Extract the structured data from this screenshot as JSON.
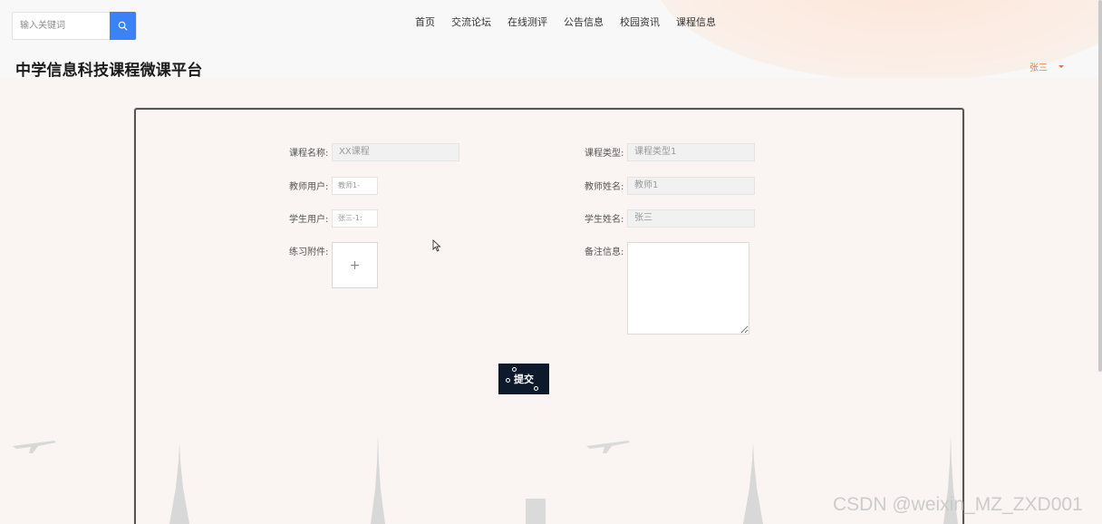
{
  "search": {
    "placeholder": "输入关键词",
    "icon": "search-icon"
  },
  "nav": [
    {
      "label": "首页"
    },
    {
      "label": "交流论坛"
    },
    {
      "label": "在线测评"
    },
    {
      "label": "公告信息"
    },
    {
      "label": "校园资讯"
    },
    {
      "label": "课程信息"
    }
  ],
  "site_title": "中学信息科技课程微课平台",
  "user": {
    "name": "张三",
    "icon": "chevron-down-icon"
  },
  "form": {
    "course_name": {
      "label": "课程名称:",
      "value": "XX课程"
    },
    "course_type": {
      "label": "课程类型:",
      "value": "课程类型1"
    },
    "teacher_user": {
      "label": "教师用户:",
      "value": "教师1-"
    },
    "teacher_name": {
      "label": "教师姓名:",
      "value": "教师1"
    },
    "student_user": {
      "label": "学生用户:",
      "value": "张三-1:"
    },
    "student_name": {
      "label": "学生姓名:",
      "value": "张三"
    },
    "attachment": {
      "label": "练习附件:",
      "upload_symbol": "+"
    },
    "remarks": {
      "label": "备注信息:",
      "value": ""
    },
    "submit_label": "提交"
  },
  "watermark": "CSDN @weixin_MZ_ZXD001",
  "colors": {
    "accent_blue": "#3b82f6",
    "user_orange": "#f07c44",
    "submit_bg": "#0c1a2c",
    "page_bg": "#faf4f2"
  }
}
